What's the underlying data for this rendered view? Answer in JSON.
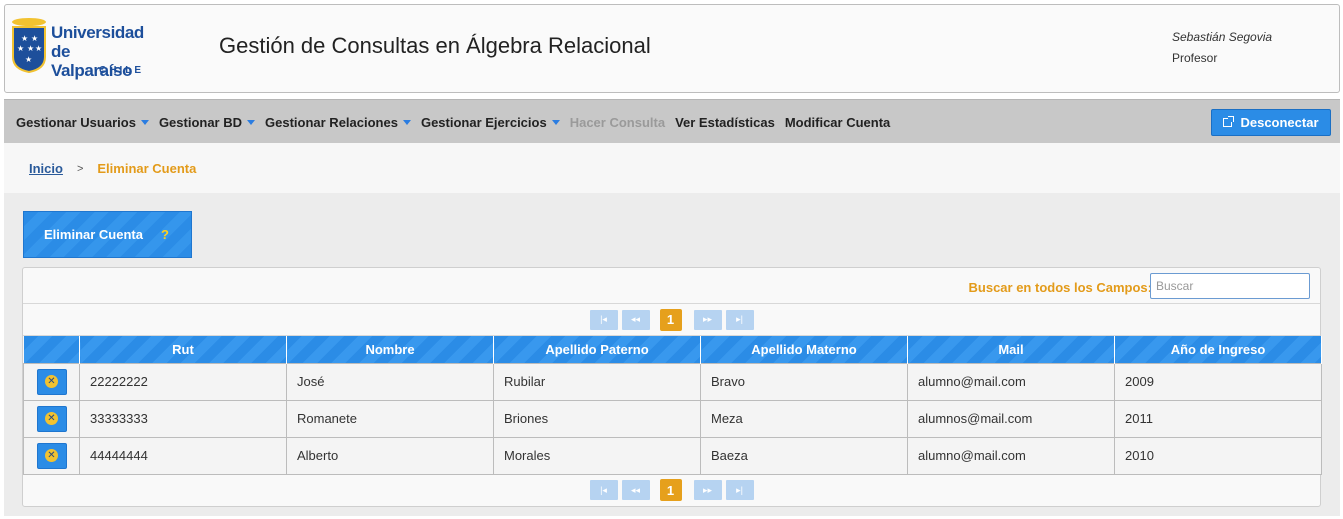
{
  "header": {
    "logo": {
      "line1": "Universidad",
      "line2": "de Valparaíso",
      "line3": "CHILE"
    },
    "title": "Gestión de Consultas en Álgebra Relacional",
    "user": {
      "name": "Sebastián Segovia",
      "role": "Profesor"
    }
  },
  "nav": {
    "items": [
      {
        "label": "Gestionar Usuarios",
        "dropdown": true
      },
      {
        "label": "Gestionar BD",
        "dropdown": true
      },
      {
        "label": "Gestionar Relaciones",
        "dropdown": true
      },
      {
        "label": "Gestionar Ejercicios",
        "dropdown": true
      },
      {
        "label": "Hacer Consulta",
        "dropdown": false,
        "disabled": true
      },
      {
        "label": "Ver Estadísticas",
        "dropdown": false
      },
      {
        "label": "Modificar Cuenta",
        "dropdown": false
      }
    ],
    "disconnect_label": "Desconectar",
    "disconnect_icon": "external-link-icon"
  },
  "breadcrumb": {
    "home": "Inicio",
    "separator": ">",
    "current": "Eliminar Cuenta"
  },
  "section": {
    "title": "Eliminar Cuenta",
    "help": "?"
  },
  "search": {
    "label": "Buscar en todos los Campos:",
    "placeholder": "Buscar",
    "value": ""
  },
  "pager": {
    "first": "|◂",
    "prev": "◂◂",
    "current_page": "1",
    "next": "▸▸",
    "last": "▸|"
  },
  "table": {
    "columns": [
      "",
      "Rut",
      "Nombre",
      "Apellido Paterno",
      "Apellido Materno",
      "Mail",
      "Año de Ingreso"
    ],
    "rows": [
      {
        "rut": "22222222",
        "nombre": "José",
        "paterno": "Rubilar",
        "materno": "Bravo",
        "mail": "alumno@mail.com",
        "ingreso": "2009"
      },
      {
        "rut": "33333333",
        "nombre": "Romanete",
        "paterno": "Briones",
        "materno": "Meza",
        "mail": "alumnos@mail.com",
        "ingreso": "2011"
      },
      {
        "rut": "44444444",
        "nombre": "Alberto",
        "paterno": "Morales",
        "materno": "Baeza",
        "mail": "alumno@mail.com",
        "ingreso": "2010"
      }
    ],
    "row_action_icon": "delete-circle-icon"
  },
  "colors": {
    "accent_blue": "#2b8ce6",
    "accent_orange": "#e39b1a",
    "navbar_bg": "#c8c8c8",
    "brand_blue": "#1d4f9b"
  }
}
